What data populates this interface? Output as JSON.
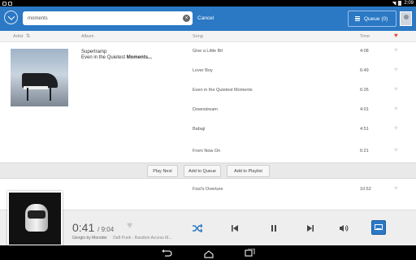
{
  "status_bar": {
    "time": "2:09",
    "icons": [
      "notification-icon",
      "photo-icon",
      "wifi-icon",
      "battery-icon"
    ]
  },
  "app_bar": {
    "search": {
      "value": "moments",
      "placeholder": ""
    },
    "cancel_label": "Cancel",
    "queue_label": "Queue (0)"
  },
  "columns": {
    "artist": "Artist",
    "album": "Album",
    "song": "Song",
    "time": "Time"
  },
  "album_result": {
    "artist": "Supertramp",
    "album_prefix": "Even in the Quietest ",
    "album_highlight": "Moments..."
  },
  "songs": [
    {
      "title": "Give a Little Bit",
      "time": "4:08"
    },
    {
      "title": "Lover Boy",
      "time": "6:49"
    },
    {
      "title": "Even in the Quietest Moments",
      "time": "6:26"
    },
    {
      "title": "Downstream",
      "time": "4:01"
    },
    {
      "title": "Babaji",
      "time": "4:51"
    },
    {
      "title": "From Now On",
      "time": "6:21"
    },
    {
      "title": "Fool's Overture",
      "time": "10:52"
    }
  ],
  "actions": {
    "play_next": "Play Next",
    "add_queue": "Add to Queue",
    "add_playlist": "Add to Playlist"
  },
  "now_playing": {
    "elapsed": "0:41",
    "total": "9:04",
    "song": "Giorgio by Moroder",
    "album_info": "Daft Punk - Random Access M..."
  },
  "colors": {
    "accent": "#2b78c5",
    "heart_active": "#e8453c"
  }
}
